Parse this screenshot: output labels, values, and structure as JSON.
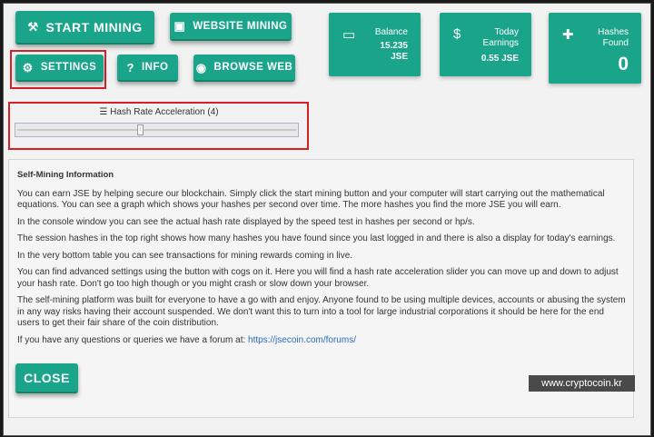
{
  "toolbar": {
    "start_mining": "START MINING",
    "website_mining": "WEBSITE MINING",
    "settings": "SETTINGS",
    "info": "INFO",
    "browse_web": "BROWSE WEB"
  },
  "icons": {
    "hammer": "⚒",
    "web": "▣",
    "cogs": "⚙",
    "question": "?",
    "globe": "◉",
    "sliders": "☰",
    "box": "▭",
    "money": "$",
    "puzzle": "✚"
  },
  "slider": {
    "label": "Hash Rate Acceleration (4)",
    "level_fraction": 0.44
  },
  "stats": {
    "balance": {
      "label": "Balance",
      "value": "15.235 JSE"
    },
    "today": {
      "label1": "Today",
      "label2": "Earnings",
      "value": "0.55 JSE"
    },
    "hashes": {
      "label1": "Hashes",
      "label2": "Found",
      "value": "0"
    }
  },
  "info": {
    "title": "Self-Mining Information",
    "p1": "You can earn JSE by helping secure our blockchain. Simply click the start mining button and your computer will start carrying out the mathematical equations. You can see a graph which shows your hashes per second over time. The more hashes you find the more JSE you will earn.",
    "p2": "In the console window you can see the actual hash rate displayed by the speed test in hashes per second or hp/s.",
    "p3": "The session hashes in the top right shows how many hashes you have found since you last logged in and there is also a display for today's earnings.",
    "p4": "In the very bottom table you can see transactions for mining rewards coming in live.",
    "p5": "You can find advanced settings using the button with cogs on it. Here you will find a hash rate acceleration slider you can move up and down to adjust your hash rate. Don't go too high though or you might crash or slow down your browser.",
    "p6": "The self-mining platform was built for everyone to have a go with and enjoy. Anyone found to be using multiple devices, accounts or abusing the system in any way risks having their account suspended. We don't want this to turn into a tool for large industrial corporations it should be here for the end users to get their fair share of the coin distribution.",
    "p7_prefix": "If you have any questions or queries we have a forum at: ",
    "forum_link": "https://jsecoin.com/forums/",
    "close": "CLOSE"
  },
  "watermark": "www.cryptocoin.kr"
}
